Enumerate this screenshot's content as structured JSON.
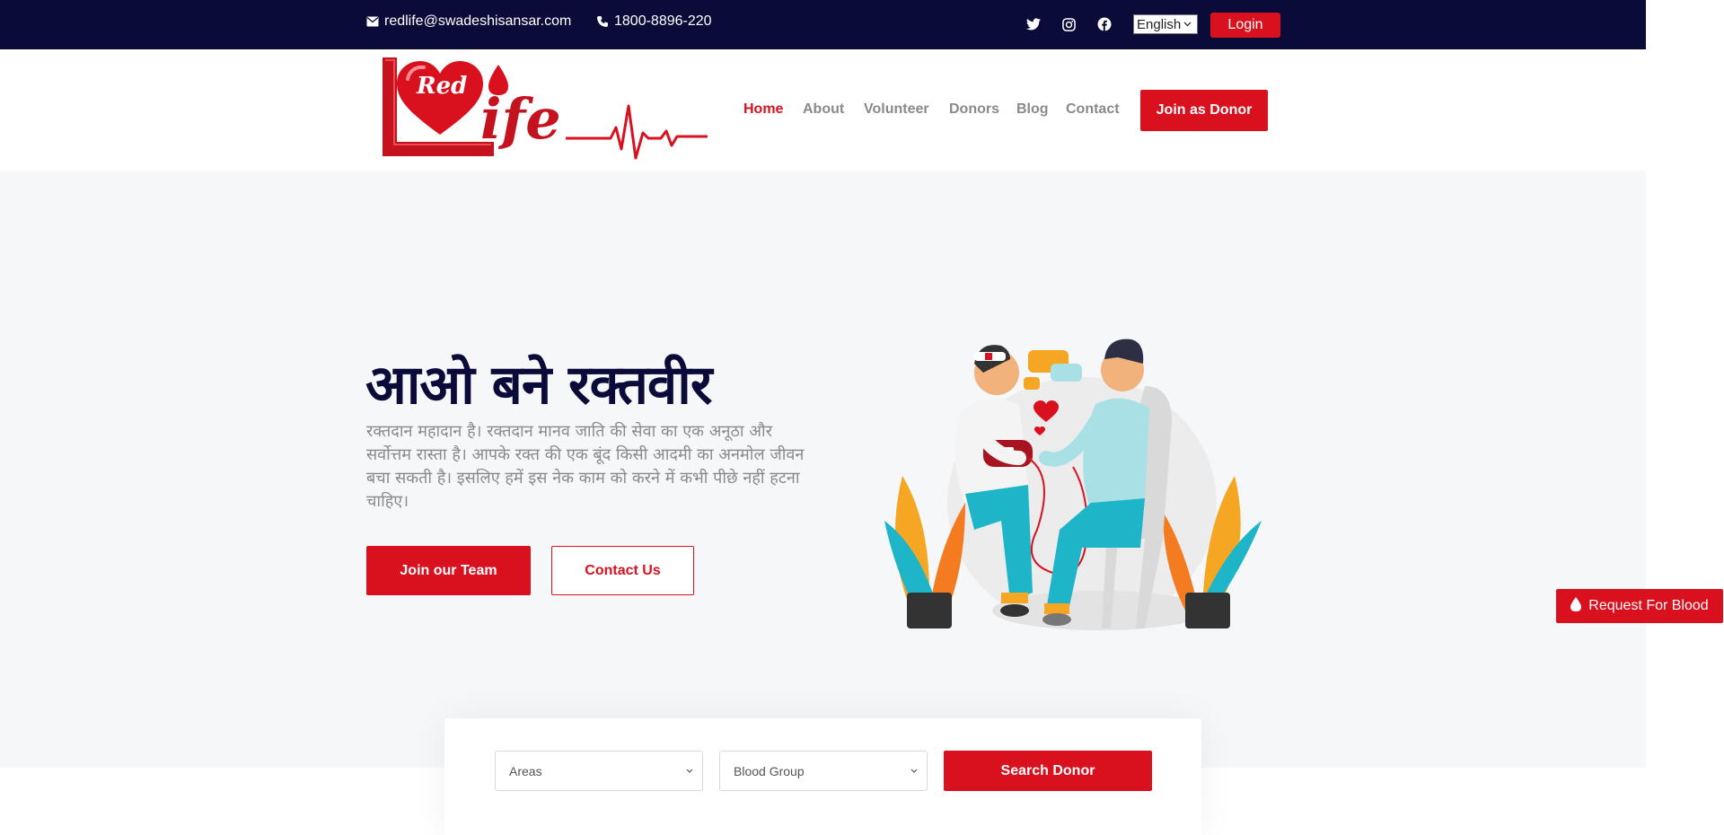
{
  "topbar": {
    "email": "redlife@swadeshisansar.com",
    "phone": "1800-8896-220",
    "social_icons": [
      "twitter-icon",
      "instagram-icon",
      "facebook-icon"
    ],
    "language": "English",
    "login_label": "Login"
  },
  "logo": {
    "word_red": "Red",
    "word_life": "ife",
    "letter_l": "L"
  },
  "nav": {
    "items": [
      {
        "label": "Home",
        "active": true
      },
      {
        "label": "About"
      },
      {
        "label": "Volunteer"
      },
      {
        "label": "Donors"
      },
      {
        "label": "Blog"
      },
      {
        "label": "Contact"
      }
    ],
    "cta_label": "Join as Donor"
  },
  "hero": {
    "title": "आओ बने रक्तवीर",
    "text": "रक्तदान महादान है। रक्तदान मानव जाति की सेवा का एक अनूठा और सर्वोत्तम रास्ता है। आपके रक्त की एक बूंद किसी आदमी का अनमोल जीवन बचा सकती है। इसलिए हमें इस नेक काम को करने में कभी पीछे नहीं हटना चाहिए।",
    "primary_button": "Join our Team",
    "secondary_button": "Contact Us"
  },
  "request_button": "Request For Blood",
  "search": {
    "areas_placeholder": "Areas",
    "blood_group_placeholder": "Blood Group",
    "button_label": "Search Donor"
  },
  "colors": {
    "primary_red": "#d9111f",
    "navy": "#0b0b3a",
    "hero_bg": "#f6f7f9",
    "muted_text": "#8a8a8a"
  }
}
